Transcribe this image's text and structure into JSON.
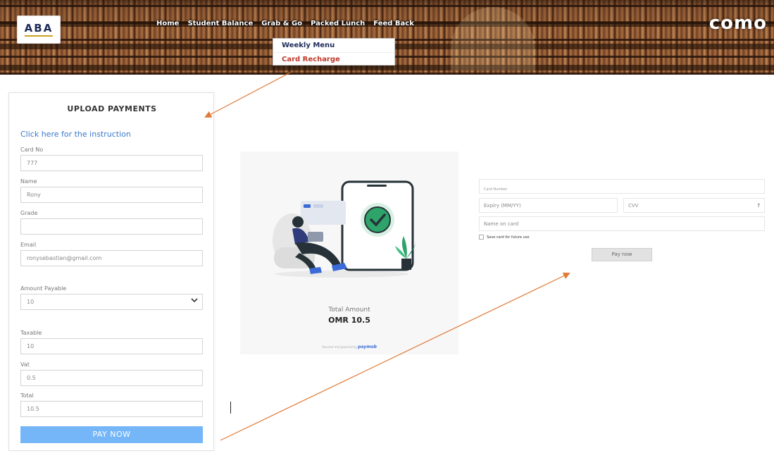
{
  "header": {
    "logo_text": "ABA",
    "brand": "como",
    "nav": [
      "Home",
      "Student Balance",
      "Grab & Go",
      "Packed Lunch",
      "Feed Back"
    ],
    "dropdown": [
      "Weekly Menu",
      "Card Recharge"
    ]
  },
  "form": {
    "title": "UPLOAD PAYMENTS",
    "instruction_link": "Click here for the instruction",
    "fields": {
      "card_no": {
        "label": "Card No",
        "value": "777"
      },
      "name": {
        "label": "Name",
        "value": "Rony"
      },
      "grade": {
        "label": "Grade",
        "value": ""
      },
      "email": {
        "label": "Email",
        "value": "ronysebastian@gmail.com"
      },
      "amount": {
        "label": "Amount Payable",
        "value": "10"
      },
      "taxable": {
        "label": "Taxable",
        "value": "10"
      },
      "vat": {
        "label": "Vat",
        "value": "0.5"
      },
      "total": {
        "label": "Total",
        "value": "10.5"
      }
    },
    "submit_label": "PAY NOW"
  },
  "payment": {
    "total_label": "Total Amount",
    "total_amount": "OMR 10.5",
    "powered_text": "Secured and powered by",
    "powered_brand": "paymob",
    "card_number_label": "Card Number",
    "expiry_placeholder": "Expiry (MM/YY)",
    "cvv_placeholder": "CVV",
    "cvv_help": "?",
    "name_placeholder": "Name on card",
    "save_card_label": "Save card for future use",
    "pay_label": "Pay now"
  },
  "colors": {
    "link": "#3a78c9",
    "primary_button": "#74b6f7",
    "annotation_arrow": "#e07b39",
    "check_green": "#2ea36a",
    "dropdown_active": "#c0392b"
  }
}
